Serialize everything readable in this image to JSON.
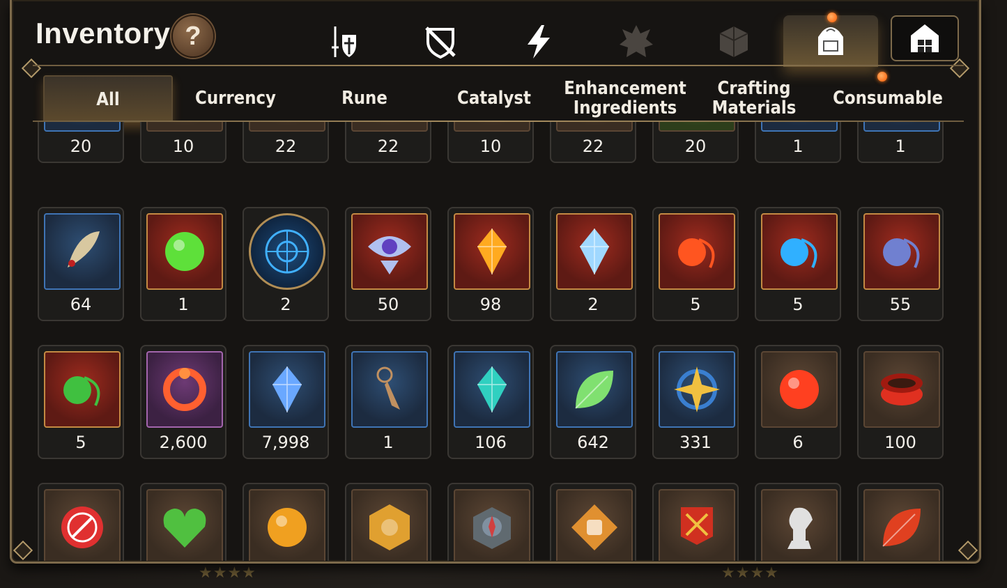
{
  "window": {
    "title": "Inventory"
  },
  "help_button": {
    "label": "?"
  },
  "category_tabs": [
    {
      "icon": "sword-shield-icon"
    },
    {
      "icon": "crossed-shield-icon"
    },
    {
      "icon": "lightning-icon"
    },
    {
      "icon": "spiky-crest-icon"
    },
    {
      "icon": "cube-icon"
    },
    {
      "icon": "backpack-icon",
      "active": true
    },
    {
      "icon": "storage-house-icon"
    }
  ],
  "subtabs": [
    {
      "label": "All",
      "active": true
    },
    {
      "label": "Currency"
    },
    {
      "label": "Rune"
    },
    {
      "label": "Catalyst"
    },
    {
      "label": "Enhancement Ingredients"
    },
    {
      "label": "Crafting Materials"
    },
    {
      "label": "Consumable"
    }
  ],
  "items": {
    "row1": [
      {
        "count": "20",
        "icon": "purple-gem-icon",
        "color": "#c03ad0",
        "frame": "blue"
      },
      {
        "count": "10",
        "icon": "pink-gem-icon",
        "color": "#e04090",
        "frame": "brown"
      },
      {
        "count": "22",
        "icon": "orange-gem-icon",
        "color": "#ff7a20",
        "frame": "brown"
      },
      {
        "count": "22",
        "icon": "cyan-gem-icon",
        "color": "#3ad0e0",
        "frame": "brown"
      },
      {
        "count": "10",
        "icon": "yellow-gem-icon",
        "color": "#ffc020",
        "frame": "brown"
      },
      {
        "count": "22",
        "icon": "green-gem-icon",
        "color": "#50e060",
        "frame": "brown"
      },
      {
        "count": "20",
        "icon": "claw-icon",
        "color": "#a08060",
        "frame": "green"
      },
      {
        "count": "1",
        "icon": "relic-icon",
        "color": "#d0a040",
        "frame": "blue"
      },
      {
        "count": "1",
        "icon": "golden-orb-icon",
        "color": "#f0b030",
        "frame": "blue"
      }
    ],
    "row2": [
      {
        "count": "64",
        "icon": "feather-charm-icon",
        "color": "#d8c8a0",
        "frame": "blue"
      },
      {
        "count": "1",
        "icon": "green-jewel-icon",
        "color": "#5ee03a",
        "frame": "red"
      },
      {
        "count": "2",
        "icon": "blue-rune-disc-icon",
        "color": "#40b0ff",
        "frame": "round"
      },
      {
        "count": "50",
        "icon": "eye-emblem-icon",
        "color": "#b0c0f0",
        "frame": "red"
      },
      {
        "count": "98",
        "icon": "amber-crystal-icon",
        "color": "#ffaa20",
        "frame": "red"
      },
      {
        "count": "2",
        "icon": "triangle-crystal-icon",
        "color": "#a0d8ff",
        "frame": "red"
      },
      {
        "count": "5",
        "icon": "fire-charm-icon",
        "color": "#ff5520",
        "frame": "red"
      },
      {
        "count": "5",
        "icon": "water-drop-charm-icon",
        "color": "#30b0ff",
        "frame": "red"
      },
      {
        "count": "55",
        "icon": "moon-charm-icon",
        "color": "#7080d0",
        "frame": "red"
      }
    ],
    "row3": [
      {
        "count": "5",
        "icon": "clover-charm-icon",
        "color": "#40c040",
        "frame": "red"
      },
      {
        "count": "2,600",
        "icon": "flower-ring-icon",
        "color": "#ff6030",
        "frame": "purple"
      },
      {
        "count": "7,998",
        "icon": "blue-crystal-icon",
        "color": "#6aa8ff",
        "frame": "blue"
      },
      {
        "count": "1",
        "icon": "pendulum-icon",
        "color": "#c09060",
        "frame": "blue"
      },
      {
        "count": "106",
        "icon": "teal-crystal-icon",
        "color": "#30d0c0",
        "frame": "blue"
      },
      {
        "count": "642",
        "icon": "leaf-icon",
        "color": "#80e070",
        "frame": "blue"
      },
      {
        "count": "331",
        "icon": "compass-star-icon",
        "color": "#f0c040",
        "frame": "blue"
      },
      {
        "count": "6",
        "icon": "lava-orb-icon",
        "color": "#ff4020",
        "frame": "brown"
      },
      {
        "count": "100",
        "icon": "red-bracelet-icon",
        "color": "#e03020",
        "frame": "brown"
      }
    ],
    "row4": [
      {
        "icon": "red-seal-icon",
        "color": "#e03030",
        "frame": "brown"
      },
      {
        "icon": "green-heart-icon",
        "color": "#50c040",
        "frame": "brown"
      },
      {
        "icon": "sun-coin-icon",
        "color": "#f0a020",
        "frame": "brown"
      },
      {
        "icon": "gold-emblem-icon",
        "color": "#e0a030",
        "frame": "brown"
      },
      {
        "icon": "stone-compass-icon",
        "color": "#8090a0",
        "frame": "brown"
      },
      {
        "icon": "fist-badge-icon",
        "color": "#e09030",
        "frame": "brown"
      },
      {
        "icon": "war-banner-icon",
        "color": "#d03020",
        "frame": "brown"
      },
      {
        "icon": "knight-chess-icon",
        "color": "#e0e0e0",
        "frame": "brown"
      },
      {
        "icon": "red-leaf-icon",
        "color": "#e04020",
        "frame": "brown"
      }
    ]
  }
}
